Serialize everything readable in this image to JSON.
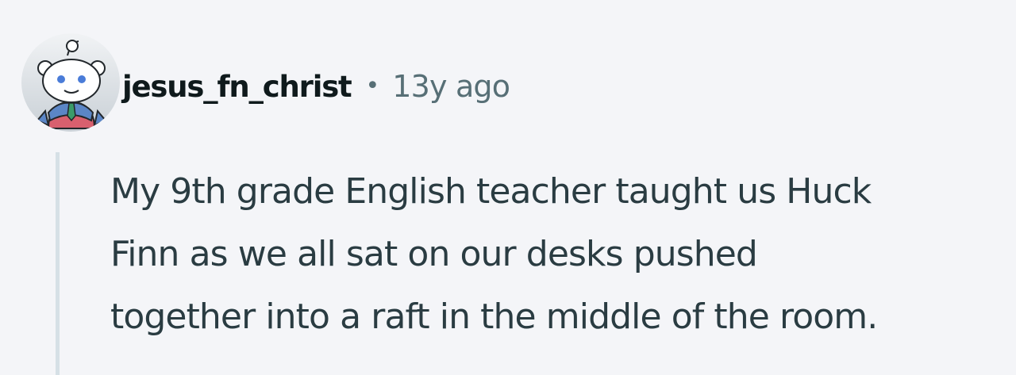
{
  "comment": {
    "author": "jesus_fn_christ",
    "separator": "•",
    "age": "13y ago",
    "avatar_icon": "snoo-avatar-icon",
    "body_lines": [
      "My 9th grade English teacher taught us Huck",
      "Finn as we all sat on our desks pushed",
      "together into a raft in the middle of the room."
    ]
  },
  "colors": {
    "background": "#f4f5f8",
    "username": "#0f1a1c",
    "meta": "#576f76",
    "body": "#2a3c42",
    "thread_line": "#d6e0e6"
  }
}
